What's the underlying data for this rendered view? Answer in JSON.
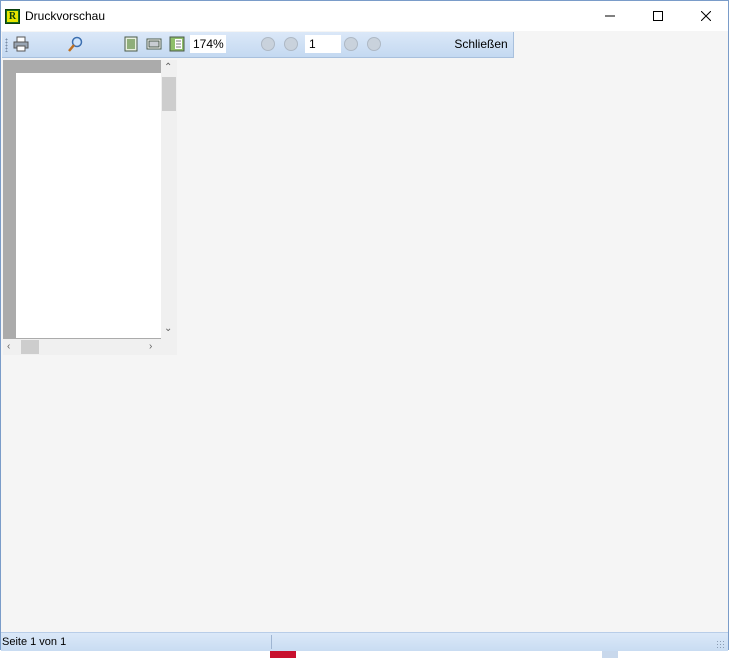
{
  "window": {
    "title": "Druckvorschau",
    "icon_letter": "R"
  },
  "toolbar": {
    "zoom_value": "174%",
    "page_value": "1",
    "close_label": "Schließen"
  },
  "status": {
    "text": "Seite 1 von 1"
  },
  "colors": {
    "toolbar_bg": "#c4d9f1",
    "window_border": "#7a9cc9",
    "preview_bg": "#ababab"
  }
}
